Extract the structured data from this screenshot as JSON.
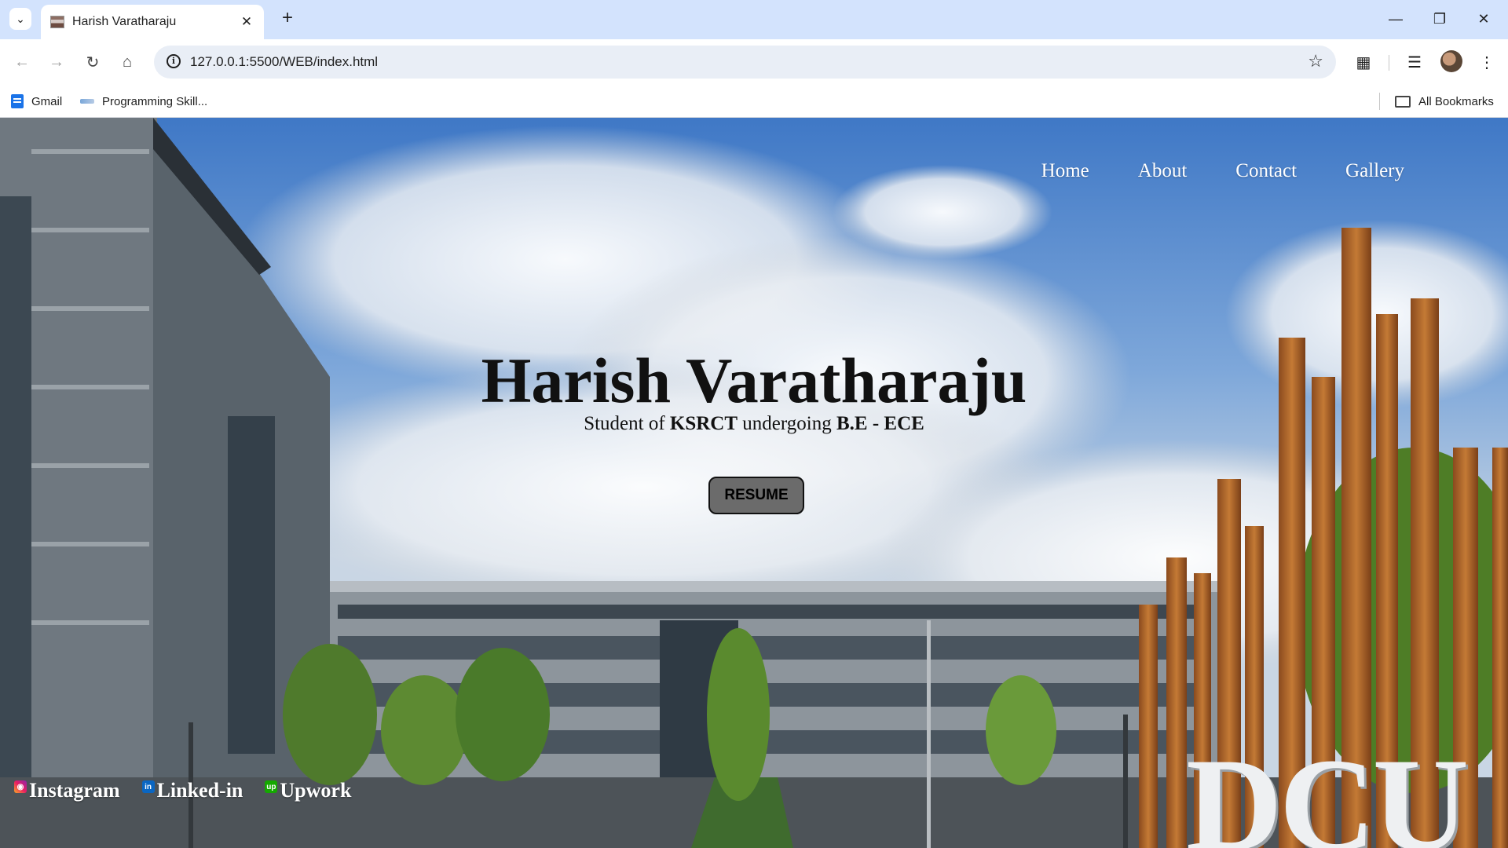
{
  "browser": {
    "tab_title": "Harish Varatharaju",
    "url": "127.0.0.1:5500/WEB/index.html",
    "bookmarks": [
      "Gmail",
      "Programming Skill..."
    ],
    "all_bookmarks": "All Bookmarks"
  },
  "nav": {
    "items": [
      "Home",
      "About",
      "Contact",
      "Gallery"
    ]
  },
  "hero": {
    "title": "Harish Varatharaju",
    "sub_prefix": "Student of ",
    "sub_college": "KSRCT",
    "sub_middle": " undergoing ",
    "sub_degree": "B.E - ECE",
    "resume_label": "RESUME",
    "sign_text": "DCU"
  },
  "socials": [
    "Instagram",
    "Linked-in",
    "Upwork"
  ],
  "colors": {
    "chrome_tab_bg": "#d3e3fd",
    "omnibox_bg": "#e9eef6",
    "nav_text": "#ffffff",
    "resume_bg": "#6b6b6b"
  }
}
